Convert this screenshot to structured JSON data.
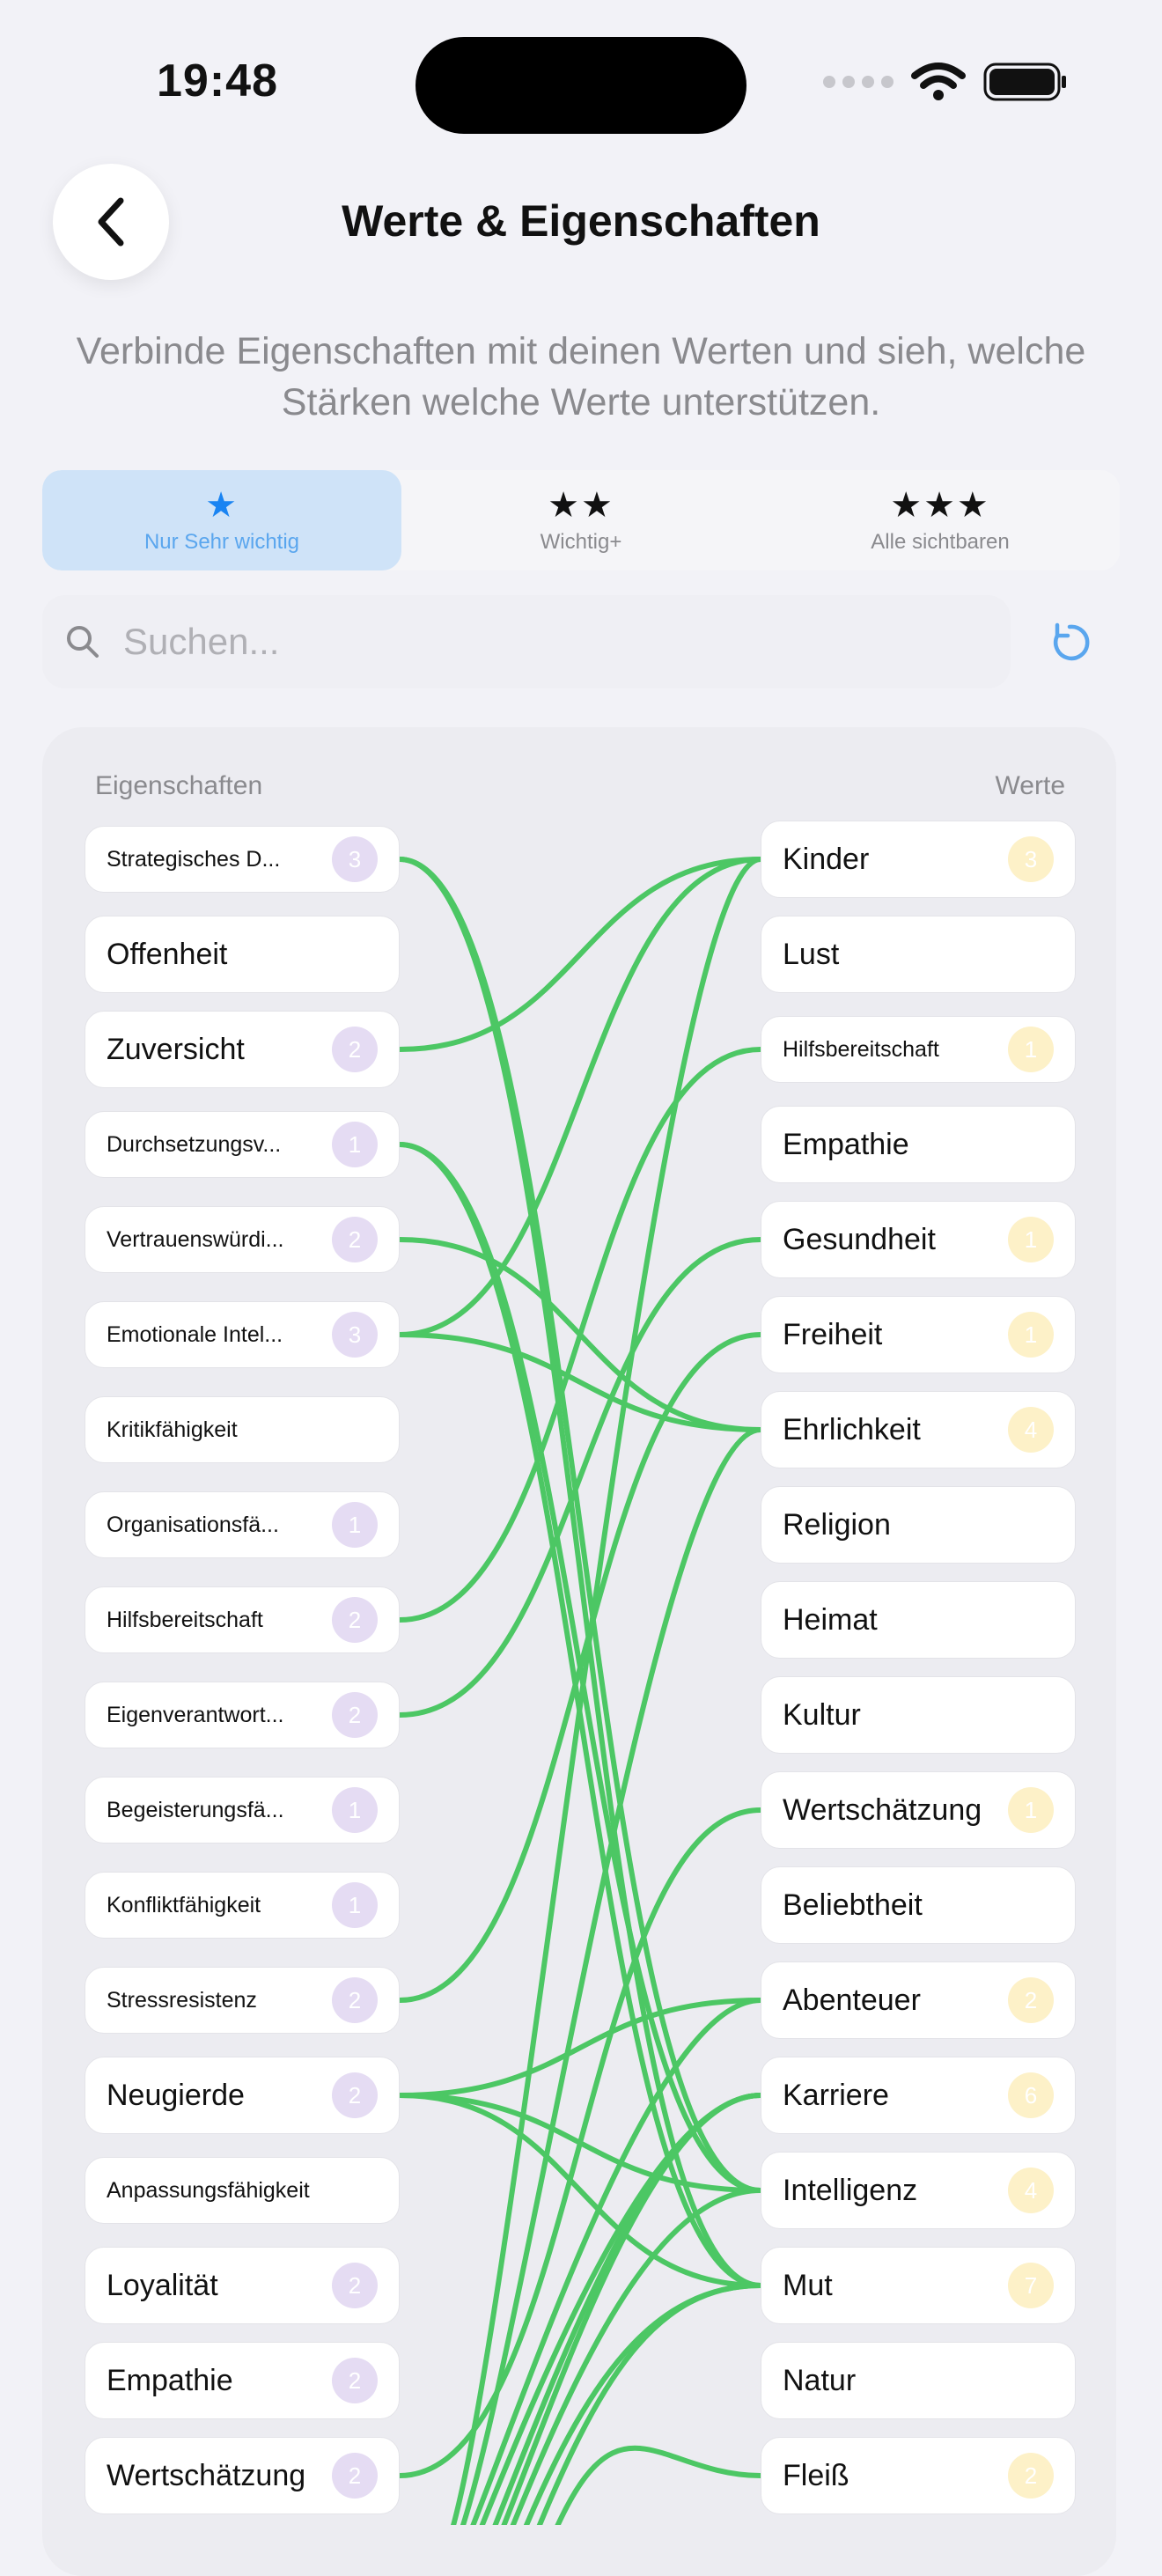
{
  "status": {
    "time": "19:48"
  },
  "title": "Werte & Eigenschaften",
  "subtitle": "Verbinde Eigenschaften mit deinen Werten und sieh, welche Stärken welche Werte unterstützen.",
  "filters": [
    {
      "stars": "★",
      "label": "Nur Sehr wichtig",
      "active": true
    },
    {
      "stars": "★★",
      "label": "Wichtig+",
      "active": false
    },
    {
      "stars": "★★★",
      "label": "Alle sichtbaren",
      "active": false
    }
  ],
  "search": {
    "placeholder": "Suchen...",
    "value": ""
  },
  "columns": {
    "left": "Eigenschaften",
    "right": "Werte"
  },
  "colors": {
    "link": "#4cc764",
    "accent": "#1a84f2",
    "badge_left": "#e5dcf3",
    "badge_right": "#fdf1c8"
  },
  "traits": [
    {
      "name": "Strategisches D...",
      "count": "3"
    },
    {
      "name": "Offenheit",
      "count": ""
    },
    {
      "name": "Zuversicht",
      "count": "2"
    },
    {
      "name": "Durchsetzungsv...",
      "count": "1"
    },
    {
      "name": "Vertrauenswürdi...",
      "count": "2"
    },
    {
      "name": "Emotionale Intel...",
      "count": "3"
    },
    {
      "name": "Kritikfähigkeit",
      "count": ""
    },
    {
      "name": "Organisationsfä...",
      "count": "1"
    },
    {
      "name": "Hilfsbereitschaft",
      "count": "2"
    },
    {
      "name": "Eigenverantwort...",
      "count": "2"
    },
    {
      "name": "Begeisterungsfä...",
      "count": "1"
    },
    {
      "name": "Konfliktfähigkeit",
      "count": "1"
    },
    {
      "name": "Stressresistenz",
      "count": "2"
    },
    {
      "name": "Neugierde",
      "count": "2"
    },
    {
      "name": "Anpassungsfähigkeit",
      "count": ""
    },
    {
      "name": "Loyalität",
      "count": "2"
    },
    {
      "name": "Empathie",
      "count": "2"
    },
    {
      "name": "Wertschätzung",
      "count": "2"
    }
  ],
  "values": [
    {
      "name": "Kinder",
      "count": "3"
    },
    {
      "name": "Lust",
      "count": ""
    },
    {
      "name": "Hilfsbereitschaft",
      "count": "1"
    },
    {
      "name": "Empathie",
      "count": ""
    },
    {
      "name": "Gesundheit",
      "count": "1"
    },
    {
      "name": "Freiheit",
      "count": "1"
    },
    {
      "name": "Ehrlichkeit",
      "count": "4"
    },
    {
      "name": "Religion",
      "count": ""
    },
    {
      "name": "Heimat",
      "count": ""
    },
    {
      "name": "Kultur",
      "count": ""
    },
    {
      "name": "Wertschätzung",
      "count": "1"
    },
    {
      "name": "Beliebtheit",
      "count": ""
    },
    {
      "name": "Abenteuer",
      "count": "2"
    },
    {
      "name": "Karriere",
      "count": "6"
    },
    {
      "name": "Intelligenz",
      "count": "4"
    },
    {
      "name": "Mut",
      "count": "7"
    },
    {
      "name": "Natur",
      "count": ""
    },
    {
      "name": "Fleiß",
      "count": "2"
    }
  ],
  "links": [
    [
      0,
      14
    ],
    [
      0,
      15
    ],
    [
      2,
      0
    ],
    [
      3,
      14
    ],
    [
      3,
      15
    ],
    [
      4,
      6
    ],
    [
      5,
      0
    ],
    [
      5,
      6
    ],
    [
      8,
      2
    ],
    [
      9,
      4
    ],
    [
      12,
      5
    ],
    [
      13,
      12
    ],
    [
      13,
      14
    ],
    [
      13,
      15
    ],
    [
      17,
      10
    ]
  ],
  "offscreen_links": [
    [
      645,
      0
    ],
    [
      655,
      6
    ],
    [
      665,
      12
    ],
    [
      675,
      13
    ],
    [
      690,
      13
    ],
    [
      700,
      13
    ],
    [
      710,
      14
    ],
    [
      725,
      15
    ],
    [
      740,
      15
    ],
    [
      760,
      17
    ]
  ]
}
